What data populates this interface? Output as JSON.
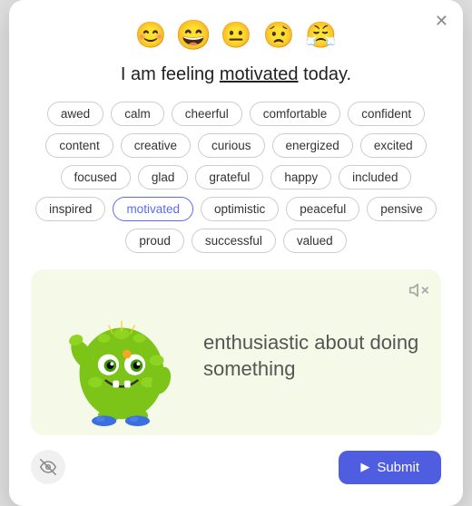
{
  "modal": {
    "close_label": "✕"
  },
  "emojis": [
    {
      "id": "emoji-happy",
      "symbol": "😊",
      "label": "happy face",
      "selected": false
    },
    {
      "id": "emoji-motivated",
      "symbol": "😄",
      "label": "motivated face",
      "selected": true
    },
    {
      "id": "emoji-neutral",
      "symbol": "😐",
      "label": "neutral face",
      "selected": false
    },
    {
      "id": "emoji-worried",
      "symbol": "😟",
      "label": "worried face",
      "selected": false
    },
    {
      "id": "emoji-angry",
      "symbol": "😤",
      "label": "angry face",
      "selected": false
    }
  ],
  "heading": {
    "prefix": "I am feeling ",
    "highlighted": "motivated",
    "suffix": " today."
  },
  "tags": [
    {
      "label": "awed",
      "selected": false
    },
    {
      "label": "calm",
      "selected": false
    },
    {
      "label": "cheerful",
      "selected": false
    },
    {
      "label": "comfortable",
      "selected": false
    },
    {
      "label": "confident",
      "selected": false
    },
    {
      "label": "content",
      "selected": false
    },
    {
      "label": "creative",
      "selected": false
    },
    {
      "label": "curious",
      "selected": false
    },
    {
      "label": "energized",
      "selected": false
    },
    {
      "label": "excited",
      "selected": false
    },
    {
      "label": "focused",
      "selected": false
    },
    {
      "label": "glad",
      "selected": false
    },
    {
      "label": "grateful",
      "selected": false
    },
    {
      "label": "happy",
      "selected": false
    },
    {
      "label": "included",
      "selected": false
    },
    {
      "label": "inspired",
      "selected": false
    },
    {
      "label": "motivated",
      "selected": true
    },
    {
      "label": "optimistic",
      "selected": false
    },
    {
      "label": "peaceful",
      "selected": false
    },
    {
      "label": "pensive",
      "selected": false
    },
    {
      "label": "proud",
      "selected": false
    },
    {
      "label": "successful",
      "selected": false
    },
    {
      "label": "valued",
      "selected": false
    }
  ],
  "illustration": {
    "description": "enthusiastic about doing something",
    "mute_icon": "🔇"
  },
  "footer": {
    "eye_icon": "👁",
    "submit_label": "Submit",
    "play_icon": "▶"
  }
}
